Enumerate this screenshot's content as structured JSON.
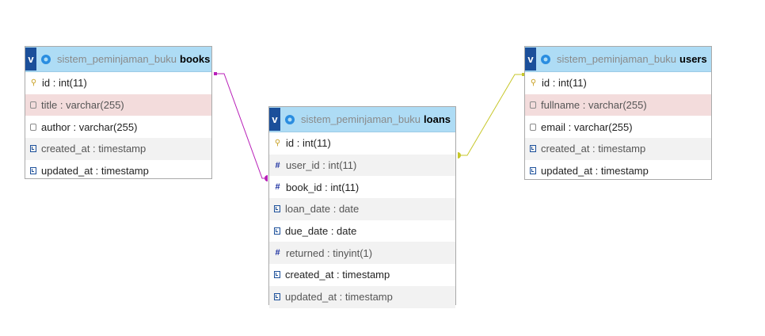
{
  "database": "sistem_peminjaman_buku",
  "toggle_label": "v",
  "colors": {
    "header": "#aedcf5",
    "link_books": "#b81fb8",
    "link_users": "#c7c72a"
  },
  "tables": {
    "books": {
      "name": "books",
      "rows": [
        {
          "text": "id : int(11)",
          "icon": "key-icon"
        },
        {
          "text": "title : varchar(255)",
          "icon": "field-icon"
        },
        {
          "text": "author : varchar(255)",
          "icon": "field-icon"
        },
        {
          "text": "created_at : timestamp",
          "icon": "timestamp-icon"
        },
        {
          "text": "updated_at : timestamp",
          "icon": "timestamp-icon"
        }
      ]
    },
    "loans": {
      "name": "loans",
      "rows": [
        {
          "text": "id : int(11)",
          "icon": "key-icon"
        },
        {
          "text": "user_id : int(11)",
          "icon": "number-icon"
        },
        {
          "text": "book_id : int(11)",
          "icon": "number-icon"
        },
        {
          "text": "loan_date : date",
          "icon": "timestamp-icon"
        },
        {
          "text": "due_date : date",
          "icon": "timestamp-icon"
        },
        {
          "text": "returned : tinyint(1)",
          "icon": "number-icon"
        },
        {
          "text": "created_at : timestamp",
          "icon": "timestamp-icon"
        },
        {
          "text": "updated_at : timestamp",
          "icon": "timestamp-icon"
        }
      ]
    },
    "users": {
      "name": "users",
      "rows": [
        {
          "text": "id : int(11)",
          "icon": "key-icon"
        },
        {
          "text": "fullname : varchar(255)",
          "icon": "field-icon"
        },
        {
          "text": "email : varchar(255)",
          "icon": "field-icon"
        },
        {
          "text": "created_at : timestamp",
          "icon": "timestamp-icon"
        },
        {
          "text": "updated_at : timestamp",
          "icon": "timestamp-icon"
        }
      ]
    }
  }
}
